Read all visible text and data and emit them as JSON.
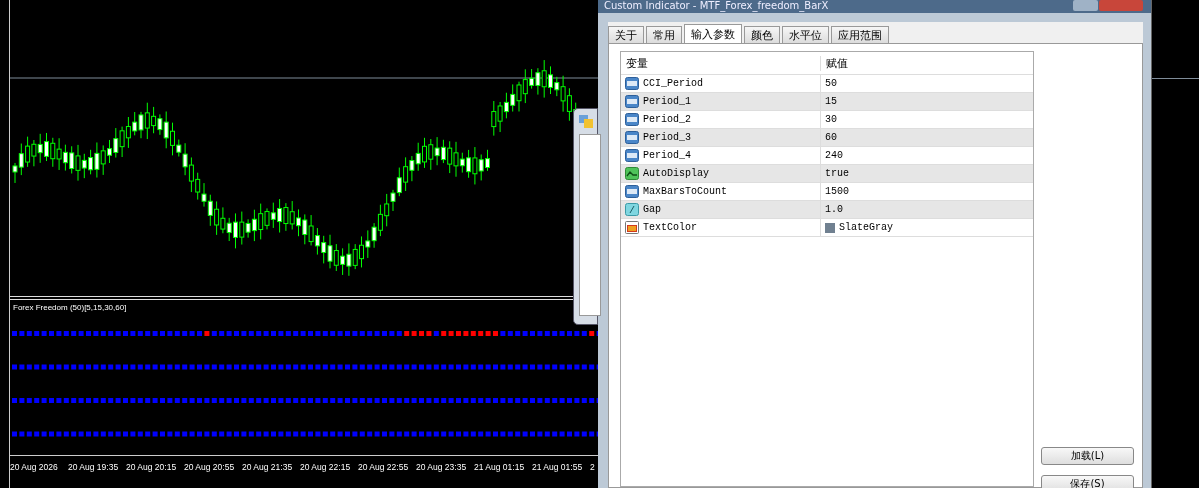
{
  "chart": {
    "indicator_label": "Forex Freedom (50)[5,15,30,60]",
    "time_axis": [
      "20 Aug 2026",
      "20 Aug 19:35",
      "20 Aug 20:15",
      "20 Aug 20:55",
      "20 Aug 21:35",
      "20 Aug 22:15",
      "20 Aug 22:55",
      "20 Aug 23:35",
      "21 Aug 01:15",
      "21 Aug 01:55",
      "2"
    ]
  },
  "dialog": {
    "title": "Custom Indicator - MTF_Forex_freedom_BarX",
    "tabs": [
      {
        "label": "关于",
        "selected": false
      },
      {
        "label": "常用",
        "selected": false
      },
      {
        "label": "输入参数",
        "selected": true
      },
      {
        "label": "颜色",
        "selected": false
      },
      {
        "label": "水平位",
        "selected": false
      },
      {
        "label": "应用范围",
        "selected": false
      }
    ],
    "columns": [
      "变量",
      "赋值"
    ],
    "parameters": [
      {
        "kind": "int",
        "name": "CCI_Period",
        "value": "50"
      },
      {
        "kind": "int",
        "name": "Period_1",
        "value": "15"
      },
      {
        "kind": "int",
        "name": "Period_2",
        "value": "30"
      },
      {
        "kind": "int",
        "name": "Period_3",
        "value": "60"
      },
      {
        "kind": "int",
        "name": "Period_4",
        "value": "240"
      },
      {
        "kind": "bool",
        "name": "AutoDisplay",
        "value": "true"
      },
      {
        "kind": "int",
        "name": "MaxBarsToCount",
        "value": "1500"
      },
      {
        "kind": "double",
        "name": "Gap",
        "value": "1.0"
      },
      {
        "kind": "color",
        "name": "TextColor",
        "value": "SlateGray",
        "color": "#708090"
      }
    ],
    "buttons": [
      "加载(L)",
      "保存(S)"
    ]
  }
}
